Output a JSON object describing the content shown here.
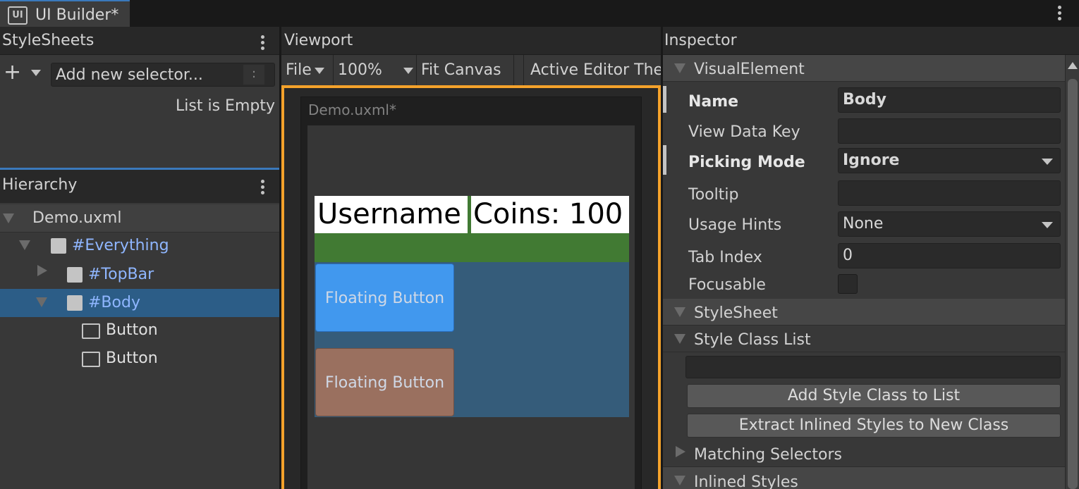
{
  "window": {
    "tab_title": "UI Builder*",
    "tab_icon": "UI"
  },
  "stylesheets": {
    "title": "StyleSheets",
    "add_selector_placeholder": "Add new selector...",
    "selector_options_glyph": ":",
    "add_glyph": "+",
    "empty_text": "List is Empty"
  },
  "hierarchy": {
    "title": "Hierarchy",
    "items": [
      {
        "label": "Demo.uxml",
        "expanded": true
      },
      {
        "label": "#Everything",
        "expanded": true
      },
      {
        "label": "#TopBar",
        "expanded": false
      },
      {
        "label": "#Body",
        "expanded": true,
        "selected": true
      },
      {
        "label": "Button"
      },
      {
        "label": "Button"
      }
    ]
  },
  "viewport": {
    "title": "Viewport",
    "toolbar": {
      "file": "File",
      "zoom": "100%",
      "fit": "Fit Canvas",
      "theme": "Active Editor Theme"
    },
    "canvas": {
      "doc_title": "Demo.uxml*",
      "username": "Username",
      "coins": "Coins: 100",
      "button1": "Floating Button",
      "button2": "Floating Button"
    }
  },
  "inspector": {
    "title": "Inspector",
    "sections": {
      "visual_element": "VisualElement",
      "stylesheet": "StyleSheet",
      "style_class_list": "Style Class List",
      "matching_selectors": "Matching Selectors",
      "inlined_styles": "Inlined Styles"
    },
    "fields": {
      "name_label": "Name",
      "name_value": "Body",
      "view_data_key_label": "View Data Key",
      "view_data_key_value": "",
      "picking_mode_label": "Picking Mode",
      "picking_mode_value": "Ignore",
      "tooltip_label": "Tooltip",
      "tooltip_value": "",
      "usage_hints_label": "Usage Hints",
      "usage_hints_value": "None",
      "tab_index_label": "Tab Index",
      "tab_index_value": "0",
      "focusable_label": "Focusable",
      "focusable_checked": false
    },
    "buttons": {
      "add_style_class": "Add Style Class to List",
      "extract_inlined": "Extract Inlined Styles to New Class"
    }
  },
  "colors": {
    "accent_blue": "#3a79bb",
    "canvas_border": "#f4a22b",
    "topbar_green": "#417a33",
    "body_blue": "#355c7a",
    "button1": "#4198ee",
    "button2": "#9a705f",
    "hierarchy_selected": "#2c5d87",
    "selector_text": "#8fb6ff"
  }
}
